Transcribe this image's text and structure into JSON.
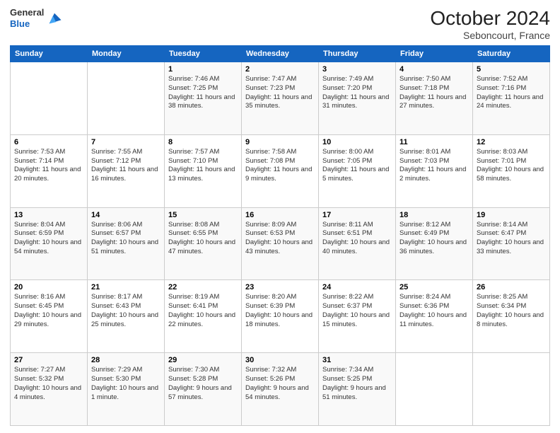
{
  "header": {
    "logo": {
      "line1": "General",
      "line2": "Blue"
    },
    "title": "October 2024",
    "location": "Seboncourt, France"
  },
  "weekdays": [
    "Sunday",
    "Monday",
    "Tuesday",
    "Wednesday",
    "Thursday",
    "Friday",
    "Saturday"
  ],
  "weeks": [
    [
      {
        "day": "",
        "sunrise": "",
        "sunset": "",
        "daylight": ""
      },
      {
        "day": "",
        "sunrise": "",
        "sunset": "",
        "daylight": ""
      },
      {
        "day": "1",
        "sunrise": "Sunrise: 7:46 AM",
        "sunset": "Sunset: 7:25 PM",
        "daylight": "Daylight: 11 hours and 38 minutes."
      },
      {
        "day": "2",
        "sunrise": "Sunrise: 7:47 AM",
        "sunset": "Sunset: 7:23 PM",
        "daylight": "Daylight: 11 hours and 35 minutes."
      },
      {
        "day": "3",
        "sunrise": "Sunrise: 7:49 AM",
        "sunset": "Sunset: 7:20 PM",
        "daylight": "Daylight: 11 hours and 31 minutes."
      },
      {
        "day": "4",
        "sunrise": "Sunrise: 7:50 AM",
        "sunset": "Sunset: 7:18 PM",
        "daylight": "Daylight: 11 hours and 27 minutes."
      },
      {
        "day": "5",
        "sunrise": "Sunrise: 7:52 AM",
        "sunset": "Sunset: 7:16 PM",
        "daylight": "Daylight: 11 hours and 24 minutes."
      }
    ],
    [
      {
        "day": "6",
        "sunrise": "Sunrise: 7:53 AM",
        "sunset": "Sunset: 7:14 PM",
        "daylight": "Daylight: 11 hours and 20 minutes."
      },
      {
        "day": "7",
        "sunrise": "Sunrise: 7:55 AM",
        "sunset": "Sunset: 7:12 PM",
        "daylight": "Daylight: 11 hours and 16 minutes."
      },
      {
        "day": "8",
        "sunrise": "Sunrise: 7:57 AM",
        "sunset": "Sunset: 7:10 PM",
        "daylight": "Daylight: 11 hours and 13 minutes."
      },
      {
        "day": "9",
        "sunrise": "Sunrise: 7:58 AM",
        "sunset": "Sunset: 7:08 PM",
        "daylight": "Daylight: 11 hours and 9 minutes."
      },
      {
        "day": "10",
        "sunrise": "Sunrise: 8:00 AM",
        "sunset": "Sunset: 7:05 PM",
        "daylight": "Daylight: 11 hours and 5 minutes."
      },
      {
        "day": "11",
        "sunrise": "Sunrise: 8:01 AM",
        "sunset": "Sunset: 7:03 PM",
        "daylight": "Daylight: 11 hours and 2 minutes."
      },
      {
        "day": "12",
        "sunrise": "Sunrise: 8:03 AM",
        "sunset": "Sunset: 7:01 PM",
        "daylight": "Daylight: 10 hours and 58 minutes."
      }
    ],
    [
      {
        "day": "13",
        "sunrise": "Sunrise: 8:04 AM",
        "sunset": "Sunset: 6:59 PM",
        "daylight": "Daylight: 10 hours and 54 minutes."
      },
      {
        "day": "14",
        "sunrise": "Sunrise: 8:06 AM",
        "sunset": "Sunset: 6:57 PM",
        "daylight": "Daylight: 10 hours and 51 minutes."
      },
      {
        "day": "15",
        "sunrise": "Sunrise: 8:08 AM",
        "sunset": "Sunset: 6:55 PM",
        "daylight": "Daylight: 10 hours and 47 minutes."
      },
      {
        "day": "16",
        "sunrise": "Sunrise: 8:09 AM",
        "sunset": "Sunset: 6:53 PM",
        "daylight": "Daylight: 10 hours and 43 minutes."
      },
      {
        "day": "17",
        "sunrise": "Sunrise: 8:11 AM",
        "sunset": "Sunset: 6:51 PM",
        "daylight": "Daylight: 10 hours and 40 minutes."
      },
      {
        "day": "18",
        "sunrise": "Sunrise: 8:12 AM",
        "sunset": "Sunset: 6:49 PM",
        "daylight": "Daylight: 10 hours and 36 minutes."
      },
      {
        "day": "19",
        "sunrise": "Sunrise: 8:14 AM",
        "sunset": "Sunset: 6:47 PM",
        "daylight": "Daylight: 10 hours and 33 minutes."
      }
    ],
    [
      {
        "day": "20",
        "sunrise": "Sunrise: 8:16 AM",
        "sunset": "Sunset: 6:45 PM",
        "daylight": "Daylight: 10 hours and 29 minutes."
      },
      {
        "day": "21",
        "sunrise": "Sunrise: 8:17 AM",
        "sunset": "Sunset: 6:43 PM",
        "daylight": "Daylight: 10 hours and 25 minutes."
      },
      {
        "day": "22",
        "sunrise": "Sunrise: 8:19 AM",
        "sunset": "Sunset: 6:41 PM",
        "daylight": "Daylight: 10 hours and 22 minutes."
      },
      {
        "day": "23",
        "sunrise": "Sunrise: 8:20 AM",
        "sunset": "Sunset: 6:39 PM",
        "daylight": "Daylight: 10 hours and 18 minutes."
      },
      {
        "day": "24",
        "sunrise": "Sunrise: 8:22 AM",
        "sunset": "Sunset: 6:37 PM",
        "daylight": "Daylight: 10 hours and 15 minutes."
      },
      {
        "day": "25",
        "sunrise": "Sunrise: 8:24 AM",
        "sunset": "Sunset: 6:36 PM",
        "daylight": "Daylight: 10 hours and 11 minutes."
      },
      {
        "day": "26",
        "sunrise": "Sunrise: 8:25 AM",
        "sunset": "Sunset: 6:34 PM",
        "daylight": "Daylight: 10 hours and 8 minutes."
      }
    ],
    [
      {
        "day": "27",
        "sunrise": "Sunrise: 7:27 AM",
        "sunset": "Sunset: 5:32 PM",
        "daylight": "Daylight: 10 hours and 4 minutes."
      },
      {
        "day": "28",
        "sunrise": "Sunrise: 7:29 AM",
        "sunset": "Sunset: 5:30 PM",
        "daylight": "Daylight: 10 hours and 1 minute."
      },
      {
        "day": "29",
        "sunrise": "Sunrise: 7:30 AM",
        "sunset": "Sunset: 5:28 PM",
        "daylight": "Daylight: 9 hours and 57 minutes."
      },
      {
        "day": "30",
        "sunrise": "Sunrise: 7:32 AM",
        "sunset": "Sunset: 5:26 PM",
        "daylight": "Daylight: 9 hours and 54 minutes."
      },
      {
        "day": "31",
        "sunrise": "Sunrise: 7:34 AM",
        "sunset": "Sunset: 5:25 PM",
        "daylight": "Daylight: 9 hours and 51 minutes."
      },
      {
        "day": "",
        "sunrise": "",
        "sunset": "",
        "daylight": ""
      },
      {
        "day": "",
        "sunrise": "",
        "sunset": "",
        "daylight": ""
      }
    ]
  ]
}
